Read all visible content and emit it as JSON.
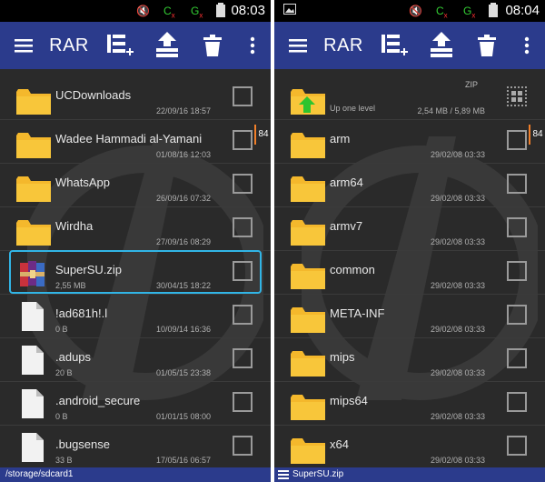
{
  "left": {
    "status": {
      "time": "08:03"
    },
    "appbar": {
      "title": "RAR"
    },
    "files": [
      {
        "name": "UCDownloads",
        "size": "",
        "date": "22/09/16 18:57",
        "type": "folder"
      },
      {
        "name": "Wadee Hammadi al-Yamani",
        "size": "",
        "date": "01/08/16 12:03",
        "type": "folder"
      },
      {
        "name": "WhatsApp",
        "size": "",
        "date": "26/09/16 07:32",
        "type": "folder"
      },
      {
        "name": "Wirdha",
        "size": "",
        "date": "27/09/16 08:29",
        "type": "folder"
      },
      {
        "name": "SuperSU.zip",
        "size": "2,55 MB",
        "date": "30/04/15 18:22",
        "type": "zip"
      },
      {
        "name": "!ad681h!.l",
        "size": "0 B",
        "date": "10/09/14 16:36",
        "type": "file"
      },
      {
        "name": ".adups",
        "size": "20 B",
        "date": "01/05/15 23:38",
        "type": "file"
      },
      {
        "name": ".android_secure",
        "size": "0 B",
        "date": "01/01/15 08:00",
        "type": "file"
      },
      {
        "name": ".bugsense",
        "size": "33 B",
        "date": "17/05/16 06:57",
        "type": "file"
      }
    ],
    "badge": "84",
    "path": "/storage/sdcard1"
  },
  "right": {
    "status": {
      "time": "08:04"
    },
    "appbar": {
      "title": "RAR"
    },
    "up": {
      "label": "Up one level",
      "size": "2,54 MB / 5,89 MB",
      "tag": "ZIP"
    },
    "files": [
      {
        "name": "arm",
        "date": "29/02/08 03:33"
      },
      {
        "name": "arm64",
        "date": "29/02/08 03:33"
      },
      {
        "name": "armv7",
        "date": "29/02/08 03:33"
      },
      {
        "name": "common",
        "date": "29/02/08 03:33"
      },
      {
        "name": "META-INF",
        "date": "29/02/08 03:33"
      },
      {
        "name": "mips",
        "date": "29/02/08 03:33"
      },
      {
        "name": "mips64",
        "date": "29/02/08 03:33"
      },
      {
        "name": "x64",
        "date": "29/02/08 03:33"
      }
    ],
    "badge": "84",
    "path": "SuperSU.zip"
  },
  "colors": {
    "appbar": "#2b3b8c",
    "background": "#2a2a2a",
    "folder": "#f4b82c",
    "highlight": "#31b5e6",
    "accent": "#f07f2a"
  }
}
